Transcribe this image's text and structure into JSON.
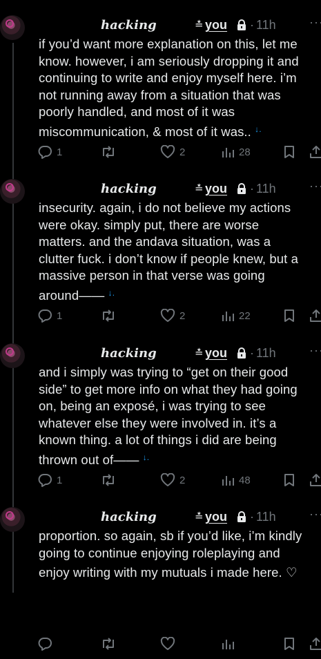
{
  "tweets": [
    {
      "name": "hacking",
      "handle_mark": "≛",
      "handle": "you",
      "dot": "·",
      "time": "11h",
      "more": "···",
      "text": "if you’d want more explanation on this, let me\nknow. however, i am seriously dropping it and\ncontinuing to write and enjoy myself here. i’m\nnot running away from a situation that was\npoorly handled, and most of it was\nmiscommunication, & most of it was..",
      "continuation": "↓.",
      "replies": "1",
      "retweets": "",
      "likes": "2",
      "views": "28"
    },
    {
      "name": "hacking",
      "handle_mark": "≛",
      "handle": "you",
      "dot": "·",
      "time": "11h",
      "more": "···",
      "text": "insecurity. again, i do not believe my actions\nwere okay. simply put, there are worse\nmatters. and the andava situation, was a\nclutter fuck. i don’t know if people knew, but a\nmassive person in that verse was going\naround——",
      "continuation": "↓.",
      "replies": "1",
      "retweets": "",
      "likes": "2",
      "views": "22"
    },
    {
      "name": "hacking",
      "handle_mark": "≛",
      "handle": "you",
      "dot": "·",
      "time": "11h",
      "more": "···",
      "text": "and i simply was trying to “get on their good\nside” to get more info on what they had going\non, being an exposé, i was trying to see\nwhatever else they were involved in. it’s a\nknown thing. a lot of things i did are being\nthrown out of——",
      "continuation": "↓.",
      "replies": "1",
      "retweets": "",
      "likes": "2",
      "views": "48"
    },
    {
      "name": "hacking",
      "handle_mark": "≛",
      "handle": "you",
      "dot": "·",
      "time": "11h",
      "more": "···",
      "text": "proportion. so again, sb if you’d like, i’m kindly\ngoing to continue enjoying roleplaying and\nenjoy writing with my mutuals i made here. ♡",
      "continuation": "",
      "replies": "",
      "retweets": "",
      "likes": "",
      "views": ""
    }
  ],
  "icons": {
    "reply": "reply-icon",
    "retweet": "retweet-icon",
    "like": "heart-icon",
    "views": "views-icon",
    "bookmark": "bookmark-icon",
    "share": "share-icon",
    "lock": "lock-icon"
  },
  "colors": {
    "background": "#000000",
    "text": "#e7e9ea",
    "muted": "#71767b",
    "accent": "#1d9bf0"
  }
}
